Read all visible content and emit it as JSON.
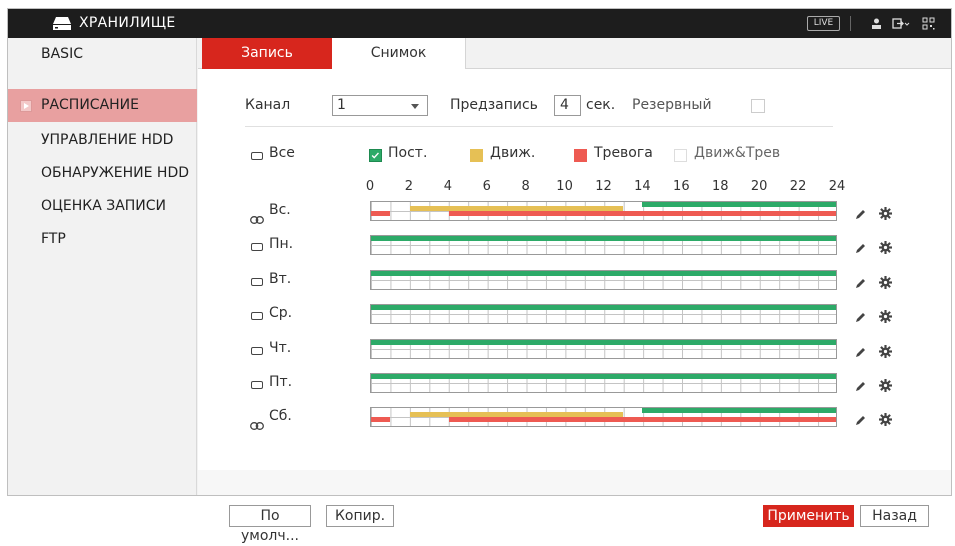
{
  "header": {
    "title": "ХРАНИЛИЩЕ",
    "live_label": "LIVE"
  },
  "sidebar": {
    "items": [
      {
        "label": "BASIC"
      },
      {
        "label": "РАСПИСАНИЕ"
      },
      {
        "label": "УПРАВЛЕНИЕ HDD"
      },
      {
        "label": "ОБНАРУЖЕНИЕ HDD"
      },
      {
        "label": "ОЦЕНКА ЗАПИСИ"
      },
      {
        "label": "FTP"
      }
    ]
  },
  "tabs": [
    {
      "label": "Запись"
    },
    {
      "label": "Снимок"
    }
  ],
  "form": {
    "channel_label": "Канал",
    "channel_value": "1",
    "prerecord_label": "Предзапись",
    "prerecord_value": "4",
    "seconds_label": "сек.",
    "backup_label": "Резервный"
  },
  "legend": {
    "all_label": "Все",
    "items": [
      {
        "label": "Пост.",
        "color": "#2daa68"
      },
      {
        "label": "Движ.",
        "color": "#e6c055"
      },
      {
        "label": "Тревога",
        "color": "#ee5a52"
      },
      {
        "label": "Движ&Трев",
        "color": "#ffffff"
      }
    ]
  },
  "hours": [
    "0",
    "2",
    "4",
    "6",
    "8",
    "10",
    "12",
    "14",
    "16",
    "18",
    "20",
    "22",
    "24"
  ],
  "schedule": [
    {
      "day": "Вс.",
      "linked": true,
      "segments": [
        {
          "type": "Пост.",
          "start": 14,
          "end": 24
        },
        {
          "type": "Движ.",
          "start": 2,
          "end": 13
        },
        {
          "type": "Тревога",
          "start": 0,
          "end": 1
        },
        {
          "type": "Тревога",
          "start": 4,
          "end": 24
        }
      ]
    },
    {
      "day": "Пн.",
      "linked": false,
      "segments": [
        {
          "type": "Пост.",
          "start": 0,
          "end": 24
        }
      ]
    },
    {
      "day": "Вт.",
      "linked": false,
      "segments": [
        {
          "type": "Пост.",
          "start": 0,
          "end": 24
        }
      ]
    },
    {
      "day": "Ср.",
      "linked": false,
      "segments": [
        {
          "type": "Пост.",
          "start": 0,
          "end": 24
        }
      ]
    },
    {
      "day": "Чт.",
      "linked": false,
      "segments": [
        {
          "type": "Пост.",
          "start": 0,
          "end": 24
        }
      ]
    },
    {
      "day": "Пт.",
      "linked": false,
      "segments": [
        {
          "type": "Пост.",
          "start": 0,
          "end": 24
        }
      ]
    },
    {
      "day": "Сб.",
      "linked": true,
      "segments": [
        {
          "type": "Пост.",
          "start": 14,
          "end": 24
        },
        {
          "type": "Движ.",
          "start": 2,
          "end": 13
        },
        {
          "type": "Тревога",
          "start": 0,
          "end": 1
        },
        {
          "type": "Тревога",
          "start": 4,
          "end": 24
        }
      ]
    }
  ],
  "footer": {
    "default_label": "По умолч...",
    "copy_label": "Копир.",
    "apply_label": "Применить",
    "back_label": "Назад"
  },
  "colors": {
    "accent": "#d7261d",
    "active_sidebar": "#e8a0a0"
  }
}
